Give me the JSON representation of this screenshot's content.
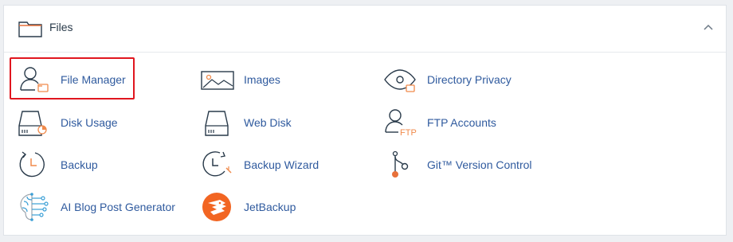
{
  "section": {
    "title": "Files",
    "icon": "folder-icon",
    "collapse_icon": "chevron-up-icon"
  },
  "items": [
    {
      "label": "File Manager",
      "icon": "file-manager-icon",
      "highlighted": true
    },
    {
      "label": "Images",
      "icon": "images-icon"
    },
    {
      "label": "Directory Privacy",
      "icon": "eye-icon"
    },
    {
      "label": "Disk Usage",
      "icon": "disk-usage-icon"
    },
    {
      "label": "Web Disk",
      "icon": "web-disk-icon"
    },
    {
      "label": "FTP Accounts",
      "icon": "ftp-accounts-icon",
      "icon_text": "FTP"
    },
    {
      "label": "Backup",
      "icon": "backup-icon"
    },
    {
      "label": "Backup Wizard",
      "icon": "backup-wizard-icon"
    },
    {
      "label": "Git™ Version Control",
      "icon": "git-icon"
    },
    {
      "label": "AI Blog Post Generator",
      "icon": "ai-brain-icon"
    },
    {
      "label": "JetBackup",
      "icon": "jetbackup-icon"
    }
  ],
  "colors": {
    "link": "#2f5a9e",
    "accent_orange": "#f08a4b",
    "highlight_border": "#e0161f",
    "icon_stroke": "#293a4a"
  }
}
